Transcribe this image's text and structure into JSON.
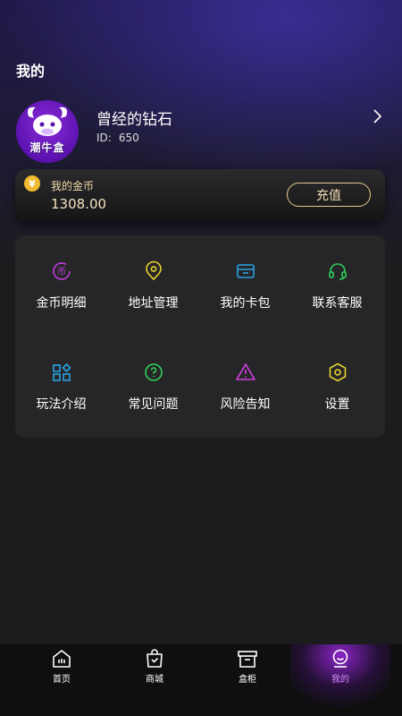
{
  "header": {
    "title": "我的"
  },
  "profile": {
    "avatar_text": "潮牛盒",
    "username": "曾经的钻石",
    "id_label": "ID:",
    "id_value": "650"
  },
  "coins": {
    "icon": "yen-coin-icon",
    "icon_glyph": "¥",
    "label": "我的金币",
    "amount": "1308.00",
    "recharge_label": "充值"
  },
  "menu": {
    "items": [
      {
        "label": "金币明细",
        "icon": "coin-detail-icon",
        "color": "#c13be0"
      },
      {
        "label": "地址管理",
        "icon": "location-pin-icon",
        "color": "#e8d62f"
      },
      {
        "label": "我的卡包",
        "icon": "card-wallet-icon",
        "color": "#28a4e0"
      },
      {
        "label": "联系客服",
        "icon": "headset-icon",
        "color": "#2fd15a"
      },
      {
        "label": "玩法介绍",
        "icon": "apps-grid-icon",
        "color": "#28a4e0"
      },
      {
        "label": "常见问题",
        "icon": "question-icon",
        "color": "#2fd15a"
      },
      {
        "label": "风险告知",
        "icon": "warning-icon",
        "color": "#d43fe0"
      },
      {
        "label": "设置",
        "icon": "settings-hex-icon",
        "color": "#e8d62f"
      }
    ]
  },
  "tabbar": {
    "tabs": [
      {
        "label": "首页",
        "icon": "home-icon"
      },
      {
        "label": "商城",
        "icon": "shopping-bag-icon"
      },
      {
        "label": "盒柜",
        "icon": "box-cabinet-icon"
      },
      {
        "label": "我的",
        "icon": "profile-icon",
        "active": true
      }
    ]
  }
}
